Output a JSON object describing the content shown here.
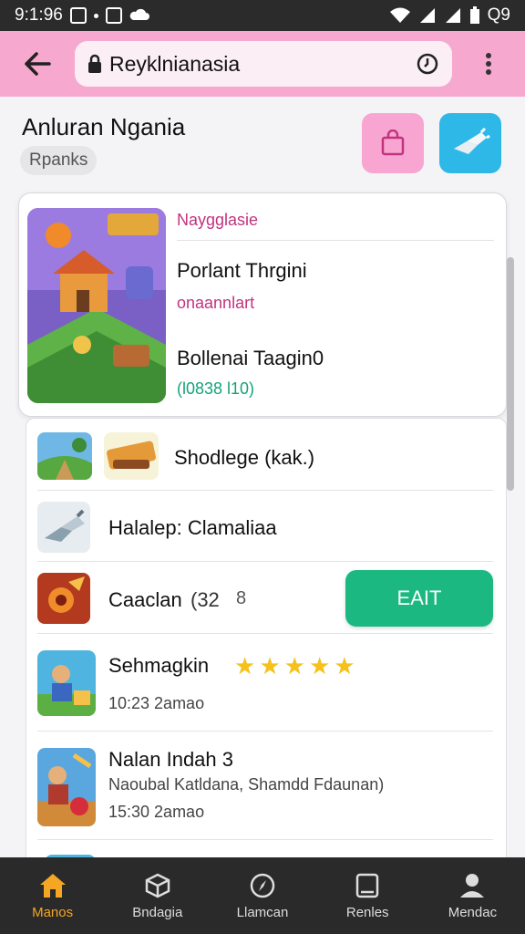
{
  "status": {
    "time": "9:1:96",
    "battery_text": "Q9"
  },
  "browser": {
    "url": "Reyklnianasia"
  },
  "page": {
    "title": "Anluran Ngania",
    "chip": "Rpanks"
  },
  "featured": {
    "tag": "Naygglasie",
    "title1": "Porlant Thrgini",
    "sub1": "onaannlart",
    "title2": "Bollenai Taagin0",
    "sub2": "(l0838 l10)"
  },
  "list": {
    "rows": [
      {
        "title": "Shodlege (kak.)"
      },
      {
        "title": "Halalep: Clamaliaa"
      },
      {
        "title": "Caaclan",
        "extra": "(32",
        "num": "8",
        "button": "EAIT"
      },
      {
        "title": "Sehmagkin",
        "sub": "10:23 2amao",
        "rating": 5
      },
      {
        "title": "Nalan Indah 3",
        "desc": "Naoubal Katldana, Shamdd Fdaunan)",
        "sub": "15:30 2amao"
      }
    ]
  },
  "nav": [
    {
      "label": "Manos",
      "icon": "home-icon"
    },
    {
      "label": "Bndagia",
      "icon": "box-icon"
    },
    {
      "label": "Llamcan",
      "icon": "compass-icon"
    },
    {
      "label": "Renles",
      "icon": "tablet-icon"
    },
    {
      "label": "Mendac",
      "icon": "person-icon"
    }
  ],
  "colors": {
    "toolbar": "#f7a8cf",
    "accent_pink": "#c2337f",
    "accent_green": "#1bb882",
    "nav_active": "#f5a623",
    "star": "#f5c11a"
  }
}
